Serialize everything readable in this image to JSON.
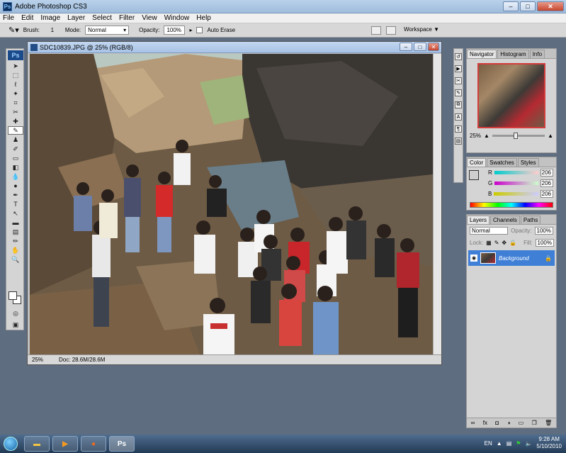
{
  "window": {
    "title": "Adobe Photoshop CS3",
    "minimize": "–",
    "maximize": "□",
    "close": "✕"
  },
  "menu": [
    "File",
    "Edit",
    "Image",
    "Layer",
    "Select",
    "Filter",
    "View",
    "Window",
    "Help"
  ],
  "options": {
    "brush_label": "Brush:",
    "brush_size": "1",
    "mode_label": "Mode:",
    "mode_value": "Normal",
    "opacity_label": "Opacity:",
    "opacity_value": "100%",
    "auto_erase_label": "Auto Erase",
    "workspace_label": "Workspace ▼"
  },
  "toolbox": {
    "badge": "Ps"
  },
  "document": {
    "title": "SDC10839.JPG @ 25% (RGB/8)",
    "zoom": "25%",
    "doc_info": "Doc: 28.6M/28.6M"
  },
  "navigator": {
    "tabs": [
      "Navigator",
      "Histogram",
      "Info"
    ],
    "zoom": "25%"
  },
  "color_panel": {
    "tabs": [
      "Color",
      "Swatches",
      "Styles"
    ],
    "channels": [
      {
        "label": "R",
        "value": "206"
      },
      {
        "label": "G",
        "value": "206"
      },
      {
        "label": "B",
        "value": "206"
      }
    ]
  },
  "layers": {
    "tabs": [
      "Layers",
      "Channels",
      "Paths"
    ],
    "blend_mode": "Normal",
    "opacity_label": "Opacity:",
    "opacity_value": "100%",
    "lock_label": "Lock:",
    "fill_label": "Fill:",
    "fill_value": "100%",
    "items": [
      {
        "name": "Background"
      }
    ]
  },
  "taskbar": {
    "ps_label": "Ps",
    "lang": "EN",
    "time": "9:28 AM",
    "date": "5/10/2010"
  },
  "colors": {
    "accent": "#3f7fd6",
    "navigator_frame": "#d43c3c"
  }
}
